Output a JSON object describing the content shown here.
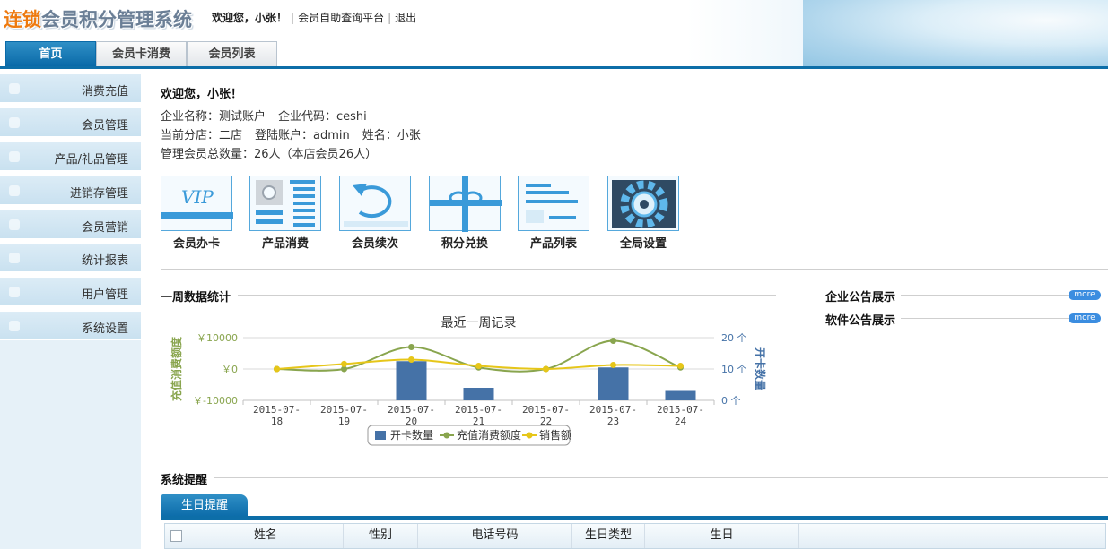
{
  "header": {
    "logo_brand": "连锁",
    "logo_rest": "会员积分管理系统",
    "welcome": "欢迎您，小张！",
    "links": [
      "会员自助查询平台",
      "退出"
    ]
  },
  "tabs": [
    {
      "label": "首页",
      "active": true
    },
    {
      "label": "会员卡消费",
      "active": false
    },
    {
      "label": "会员列表",
      "active": false
    }
  ],
  "sidebar": {
    "items": [
      {
        "label": "消费充值",
        "icon": "user-icon"
      },
      {
        "label": "会员管理",
        "icon": "card-icon"
      },
      {
        "label": "产品/礼品管理",
        "icon": "gift-icon"
      },
      {
        "label": "进销存管理",
        "icon": "gift-icon"
      },
      {
        "label": "会员营销",
        "icon": "mail-icon"
      },
      {
        "label": "统计报表",
        "icon": "monitor-icon"
      },
      {
        "label": "用户管理",
        "icon": "lock-icon"
      },
      {
        "label": "系统设置",
        "icon": "gear-icon"
      }
    ]
  },
  "welcome_panel": {
    "title": "欢迎您，小张！",
    "company_name": "企业名称：测试账户",
    "company_code": "企业代码：ceshi",
    "branch": "当前分店：二店",
    "account": "登陆账户：admin",
    "name": "姓名：小张",
    "member_count": "管理会员总数量：26人（本店会员26人）"
  },
  "shortcuts": [
    {
      "label": "会员办卡",
      "icon": "vip-card-icon"
    },
    {
      "label": "产品消费",
      "icon": "product-consume-icon"
    },
    {
      "label": "会员续次",
      "icon": "renew-icon"
    },
    {
      "label": "积分兑换",
      "icon": "gift-box-icon"
    },
    {
      "label": "产品列表",
      "icon": "product-list-icon"
    },
    {
      "label": "全局设置",
      "icon": "gear-settings-icon"
    }
  ],
  "sections": {
    "weekly": "一周数据统计",
    "enterprise_notice": "企业公告展示",
    "software_notice": "软件公告展示",
    "more": "more",
    "system_remind": "系统提醒"
  },
  "chart_data": {
    "type": "bar",
    "title": "最近一周记录",
    "categories": [
      "2015-07-18",
      "2015-07-19",
      "2015-07-20",
      "2015-07-21",
      "2015-07-22",
      "2015-07-23",
      "2015-07-24"
    ],
    "category_labels": [
      [
        "2015-07-",
        "18"
      ],
      [
        "2015-07-",
        "19"
      ],
      [
        "2015-07-",
        "20"
      ],
      [
        "2015-07-",
        "21"
      ],
      [
        "2015-07-",
        "22"
      ],
      [
        "2015-07-",
        "23"
      ],
      [
        "2015-07-",
        "24"
      ]
    ],
    "ylabel_left": "充值消费额度",
    "ylabel_right": "开卡数量",
    "ylim_left": [
      -10000,
      10000
    ],
    "ylim_right": [
      0,
      20
    ],
    "left_ticks": [
      "￥10000",
      "￥0",
      "￥-10000"
    ],
    "right_ticks": [
      "20 个",
      "10 个",
      "0 个"
    ],
    "series": [
      {
        "name": "开卡数量",
        "axis": "right",
        "kind": "bar",
        "color": "#4572a7",
        "values": [
          0,
          0,
          12.5,
          4,
          0,
          10.5,
          3
        ]
      },
      {
        "name": "充值消费额度",
        "axis": "left",
        "kind": "line",
        "color": "#89a54e",
        "values": [
          0,
          0,
          7000,
          500,
          0,
          9000,
          500
        ]
      },
      {
        "name": "销售额",
        "axis": "left",
        "kind": "line",
        "color": "#e6c619",
        "values": [
          0,
          1600,
          3000,
          1000,
          0,
          1300,
          1000
        ]
      }
    ],
    "grid": true,
    "legend": "bottom-center"
  },
  "birthday": {
    "tab_label": "生日提醒",
    "columns": [
      "姓名",
      "性别",
      "电话号码",
      "生日类型",
      "生日"
    ]
  }
}
